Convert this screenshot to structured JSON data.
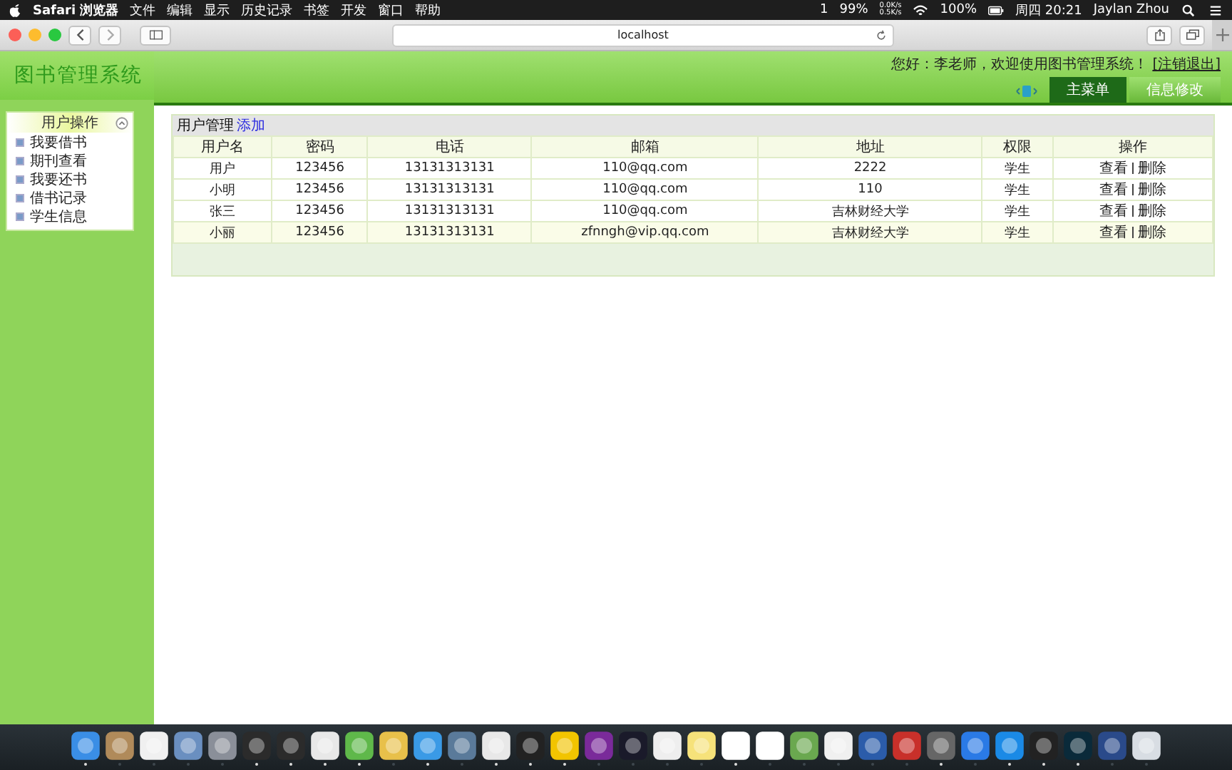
{
  "menubar": {
    "app": "Safari 浏览器",
    "menus": [
      "文件",
      "编辑",
      "显示",
      "历史记录",
      "书签",
      "开发",
      "窗口",
      "帮助"
    ],
    "status": {
      "notifications": "1",
      "battery_saver": "99%",
      "upload": "0.0K/s",
      "download": "0.5K/s",
      "battery": "100%",
      "clock": "周四 20:21",
      "user": "Jaylan Zhou"
    }
  },
  "browser": {
    "url": "localhost"
  },
  "site": {
    "logo": "图书管理系统",
    "greeting": "您好：李老师，欢迎使用图书管理系统！",
    "logout": "[注销退出]",
    "tabs": [
      {
        "label": "主菜单",
        "selected": true
      },
      {
        "label": "信息修改",
        "selected": false
      }
    ]
  },
  "sidebar": {
    "title": "用户操作",
    "items": [
      "我要借书",
      "期刊查看",
      "我要还书",
      "借书记录",
      "学生信息"
    ]
  },
  "panel": {
    "title": "用户管理",
    "add_link": "添加",
    "table": {
      "columns": [
        "用户名",
        "密码",
        "电话",
        "邮箱",
        "地址",
        "权限",
        "操作"
      ],
      "rows": [
        {
          "cells": [
            "用户",
            "123456",
            "13131313131",
            "110@qq.com",
            "2222",
            "学生"
          ],
          "actions": [
            "查看",
            "删除"
          ]
        },
        {
          "cells": [
            "小明",
            "123456",
            "13131313131",
            "110@qq.com",
            "110",
            "学生"
          ],
          "actions": [
            "查看",
            "删除"
          ]
        },
        {
          "cells": [
            "张三",
            "123456",
            "13131313131",
            "110@qq.com",
            "吉林财经大学",
            "学生"
          ],
          "actions": [
            "查看",
            "删除"
          ]
        },
        {
          "cells": [
            "小丽",
            "123456",
            "13131313131",
            "zfnngh@vip.qq.com",
            "吉林财经大学",
            "学生"
          ],
          "actions": [
            "查看",
            "删除"
          ]
        }
      ]
    }
  },
  "dock": [
    {
      "running": true
    },
    {
      "running": false
    },
    {
      "running": false
    },
    {
      "running": false
    },
    {
      "running": false
    },
    {
      "running": true
    },
    {
      "running": true
    },
    {
      "running": true
    },
    {
      "running": true
    },
    {
      "running": false
    },
    {
      "running": true
    },
    {
      "running": false
    },
    {
      "running": true
    },
    {
      "running": true
    },
    {
      "running": true
    },
    {
      "running": false
    },
    {
      "running": false
    },
    {
      "running": false
    },
    {
      "running": false
    },
    {
      "running": true
    },
    {
      "running": false
    },
    {
      "running": false
    },
    {
      "running": false
    },
    {
      "running": false
    },
    {
      "running": false
    },
    {
      "running": true
    },
    {
      "running": false
    },
    {
      "running": true
    },
    {
      "running": true
    },
    {
      "running": true
    },
    {
      "running": false
    },
    {
      "running": false
    }
  ]
}
